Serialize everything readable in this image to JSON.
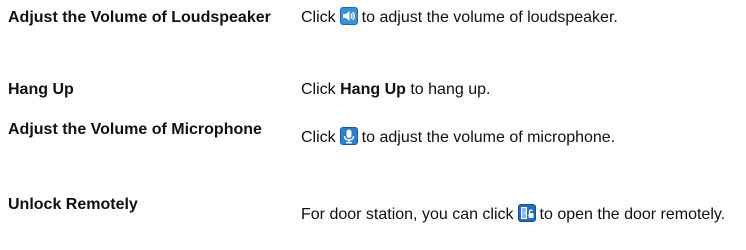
{
  "rows": [
    {
      "term": "Adjust the Volume of Loudspeaker",
      "desc_before": "Click",
      "icon": "speaker-volume-icon",
      "desc_after": "to adjust the volume of loudspeaker."
    },
    {
      "term": "Hang Up",
      "desc_before": "Click",
      "desc_bold": "Hang Up",
      "desc_after": "to hang up."
    },
    {
      "term": "Adjust the Volume of Microphone",
      "desc_before": "Click",
      "icon": "microphone-icon",
      "desc_after": "to adjust the volume of microphone."
    },
    {
      "term": "Unlock Remotely",
      "desc_before": "For door station, you can click",
      "icon": "door-unlock-icon",
      "desc_after": "to open the door remotely."
    }
  ]
}
